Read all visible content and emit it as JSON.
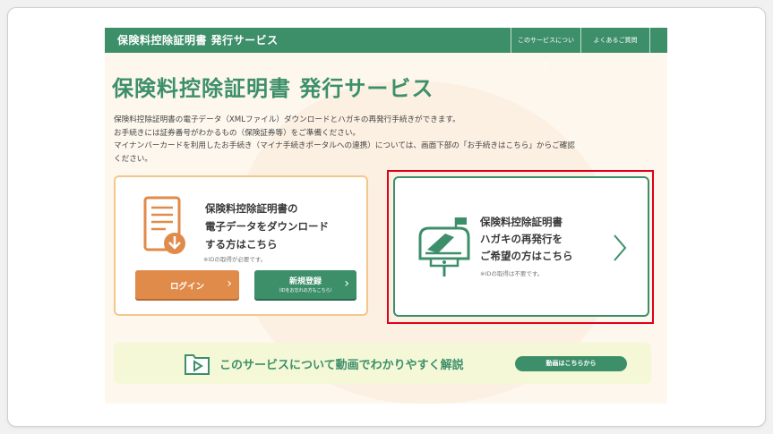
{
  "header": {
    "brand": "保険料控除証明書 発行サービス",
    "nav": [
      {
        "label": "このサービスについて"
      },
      {
        "label": "よくあるご質問"
      }
    ]
  },
  "main": {
    "title": "保険料控除証明書 発行サービス",
    "intro": [
      "保険料控除証明書の電子データ（XMLファイル）ダウンロードとハガキの再発行手続きができます。",
      "お手続きには証券番号がわかるもの（保険証券等）をご準備ください。",
      "マイナンバーカードを利用したお手続き（マイナ手続きポータルへの連携）については、画面下部の「お手続きはこちら」からご確認",
      "ください。"
    ]
  },
  "download_card": {
    "heading_line1": "保険料控除証明書の",
    "heading_line2": "電子データをダウンロード",
    "heading_line3": "する方はこちら",
    "note": "※IDの取得が必要です。",
    "login_label": "ログイン",
    "register_label": "新規登録",
    "register_sub": "（IDをお忘れの方もこちら）",
    "arrow": "›"
  },
  "postcard_card": {
    "heading_line1": "保険料控除証明書",
    "heading_line2": "ハガキの再発行を",
    "heading_line3": "ご希望の方はこちら",
    "note": "※IDの取得は不要です。"
  },
  "video_bar": {
    "text": "このサービスについて動画でわかりやすく解説",
    "button_label": "動画はこちらから"
  },
  "colors": {
    "brand_green": "#3d8f6a",
    "accent_orange": "#e08b4a",
    "highlight_red": "#e0001a",
    "card_border_orange": "#f3c78a"
  }
}
